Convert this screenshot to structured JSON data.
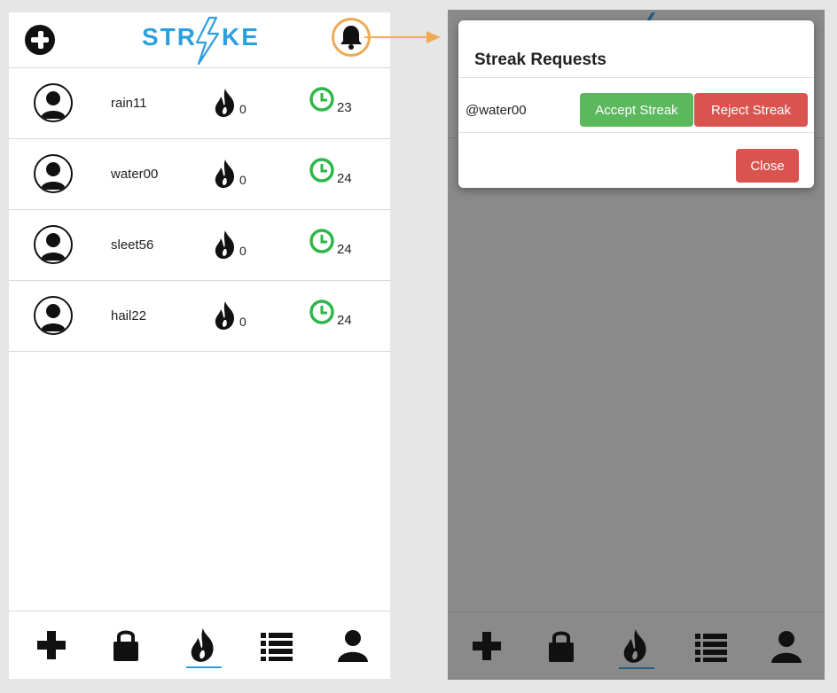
{
  "app": {
    "logo_left": "STR",
    "logo_right": "KE"
  },
  "friends": [
    {
      "username": "rain11",
      "streak": "0",
      "hours": "23"
    },
    {
      "username": "water00",
      "streak": "0",
      "hours": "24"
    },
    {
      "username": "sleet56",
      "streak": "0",
      "hours": "24"
    },
    {
      "username": "hail22",
      "streak": "0",
      "hours": "24"
    }
  ],
  "modal": {
    "title": "Streak Requests",
    "request_user": "@water00",
    "accept_label": "Accept Streak",
    "reject_label": "Reject Streak",
    "close_label": "Close"
  },
  "icons": {
    "add": "plus-circle-icon",
    "notifications": "bell-icon",
    "avatar": "user-icon",
    "streak": "fire-icon",
    "timer": "clock-icon",
    "nav": [
      "plus-icon",
      "lock-icon",
      "fire-icon",
      "list-icon",
      "user-icon"
    ]
  },
  "colors": {
    "brand": "#2aa0df",
    "highlight": "#eeaa55",
    "accept": "#5cb85c",
    "reject": "#d9534f",
    "timer": "#2fb64a"
  }
}
